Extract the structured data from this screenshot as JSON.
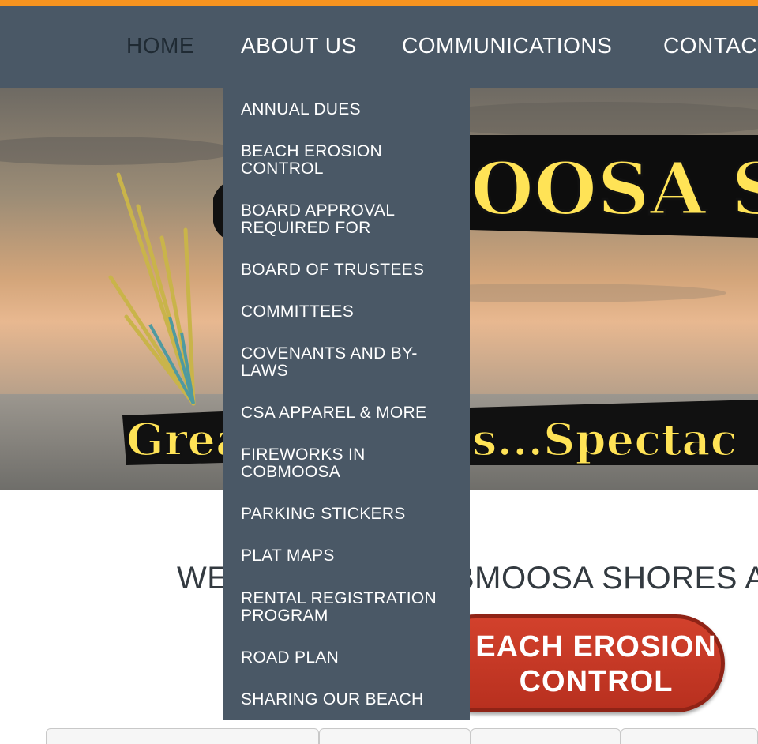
{
  "nav": {
    "items": [
      "HOME",
      "ABOUT US",
      "COMMUNICATIONS",
      "CONTAC"
    ]
  },
  "dropdown": {
    "items": [
      "ANNUAL DUES",
      "BEACH EROSION CONTROL",
      "BOARD APPROVAL REQUIRED FOR",
      "BOARD OF TRUSTEES",
      "COMMITTEES",
      "COVENANTS AND BY-LAWS",
      "CSA APPAREL & MORE",
      "FIREWORKS IN COBMOOSA",
      "PARKING STICKERS",
      "PLAT MAPS",
      "RENTAL REGISTRATION PROGRAM",
      "ROAD PLAN",
      "SHARING OUR BEACH"
    ]
  },
  "hero": {
    "title_visible": "OOSA SH",
    "tagline_left": "Grea",
    "tagline_right": "s...Spectac"
  },
  "welcome": {
    "left": "WE",
    "right": "BMOOSA SHORES A"
  },
  "erosion_button": {
    "line1": "EACH EROSION",
    "line2": "CONTROL"
  },
  "colors": {
    "accent": "#f7931e",
    "nav_bg": "#4a5866",
    "button_red": "#c8382a"
  }
}
